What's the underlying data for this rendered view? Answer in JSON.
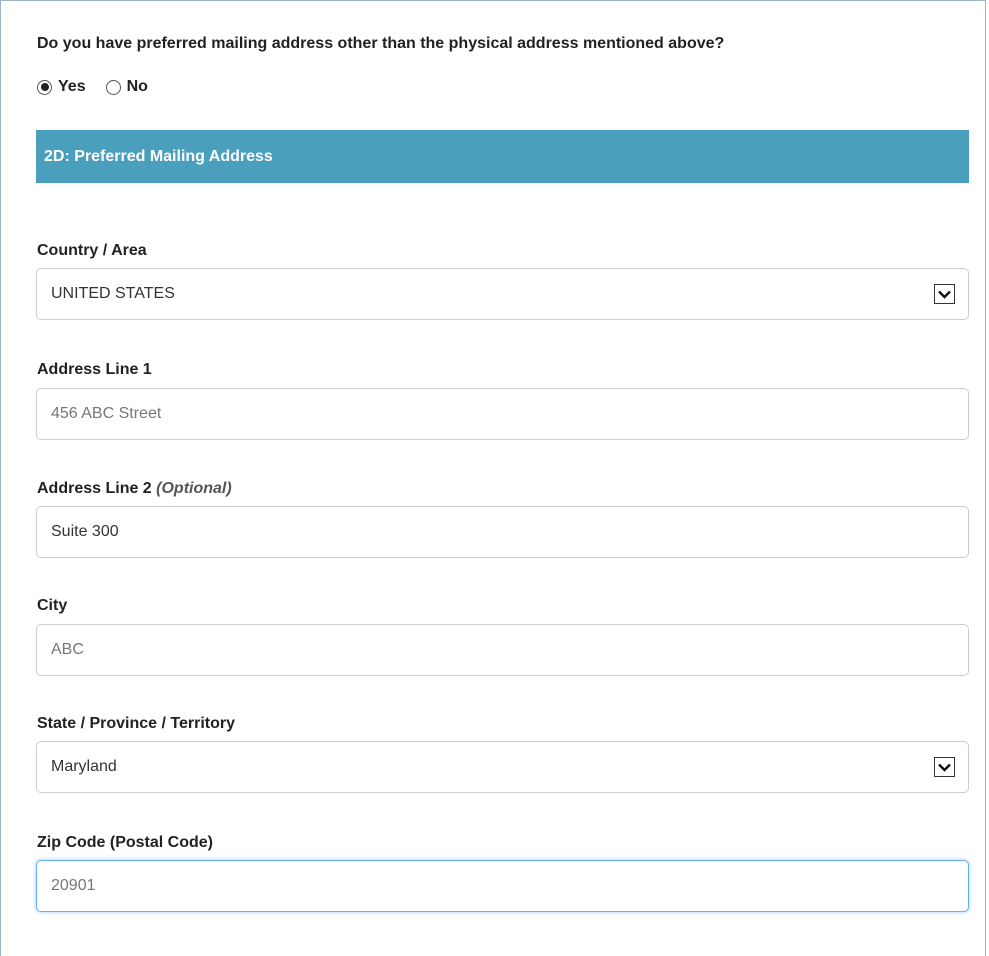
{
  "question": {
    "text": "Do you have preferred mailing address other than the physical address mentioned above?",
    "options": [
      {
        "label": "Yes",
        "selected": true
      },
      {
        "label": "No",
        "selected": false
      }
    ]
  },
  "section": {
    "title": "2D: Preferred Mailing Address",
    "color": "#4a9fbd"
  },
  "fields": {
    "country": {
      "label": "Country / Area",
      "value": "UNITED STATES",
      "icon": "chevron-down-icon"
    },
    "address1": {
      "label": "Address Line 1",
      "value": "456 ABC Street"
    },
    "address2": {
      "label": "Address Line 2",
      "optional": "(Optional)",
      "value": "Suite 300"
    },
    "city": {
      "label": "City",
      "value": "ABC"
    },
    "state": {
      "label": "State / Province / Territory",
      "value": "Maryland",
      "icon": "chevron-down-icon"
    },
    "zip": {
      "label": "Zip Code (Postal Code)",
      "value": "20901"
    }
  }
}
